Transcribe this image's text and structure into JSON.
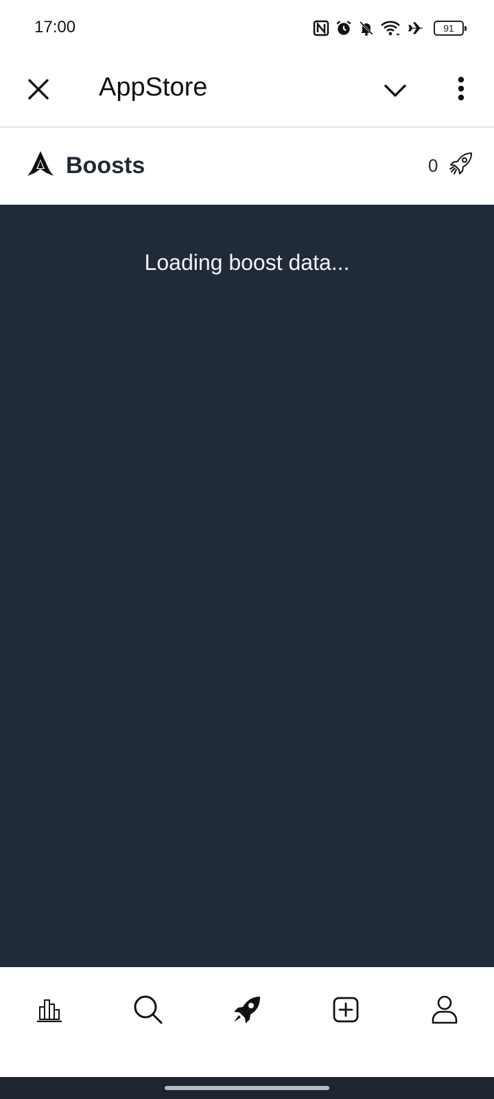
{
  "status_bar": {
    "time": "17:00",
    "battery": "91",
    "icons": [
      "nfc-icon",
      "alarm-icon",
      "bell-off-icon",
      "wifi-icon",
      "airplane-icon",
      "battery-icon"
    ]
  },
  "app_bar": {
    "title": "AppStore",
    "icons": [
      "close-icon",
      "chevron-down-icon",
      "more-vertical-icon"
    ]
  },
  "boosts": {
    "title": "Boosts",
    "count": "0",
    "icons": [
      "logo-icon",
      "rocket-outline-icon"
    ]
  },
  "content": {
    "loading_text": "Loading boost data..."
  },
  "bottom_nav": {
    "items": [
      {
        "icon": "chart-icon"
      },
      {
        "icon": "search-icon"
      },
      {
        "icon": "rocket-icon",
        "active": true
      },
      {
        "icon": "add-square-icon"
      },
      {
        "icon": "user-icon"
      }
    ]
  },
  "colors": {
    "content_bg": "#202b3a",
    "heading": "#1f2a3a",
    "loading_text": "#f3f4f6",
    "gesture_bg": "#1d2530"
  }
}
